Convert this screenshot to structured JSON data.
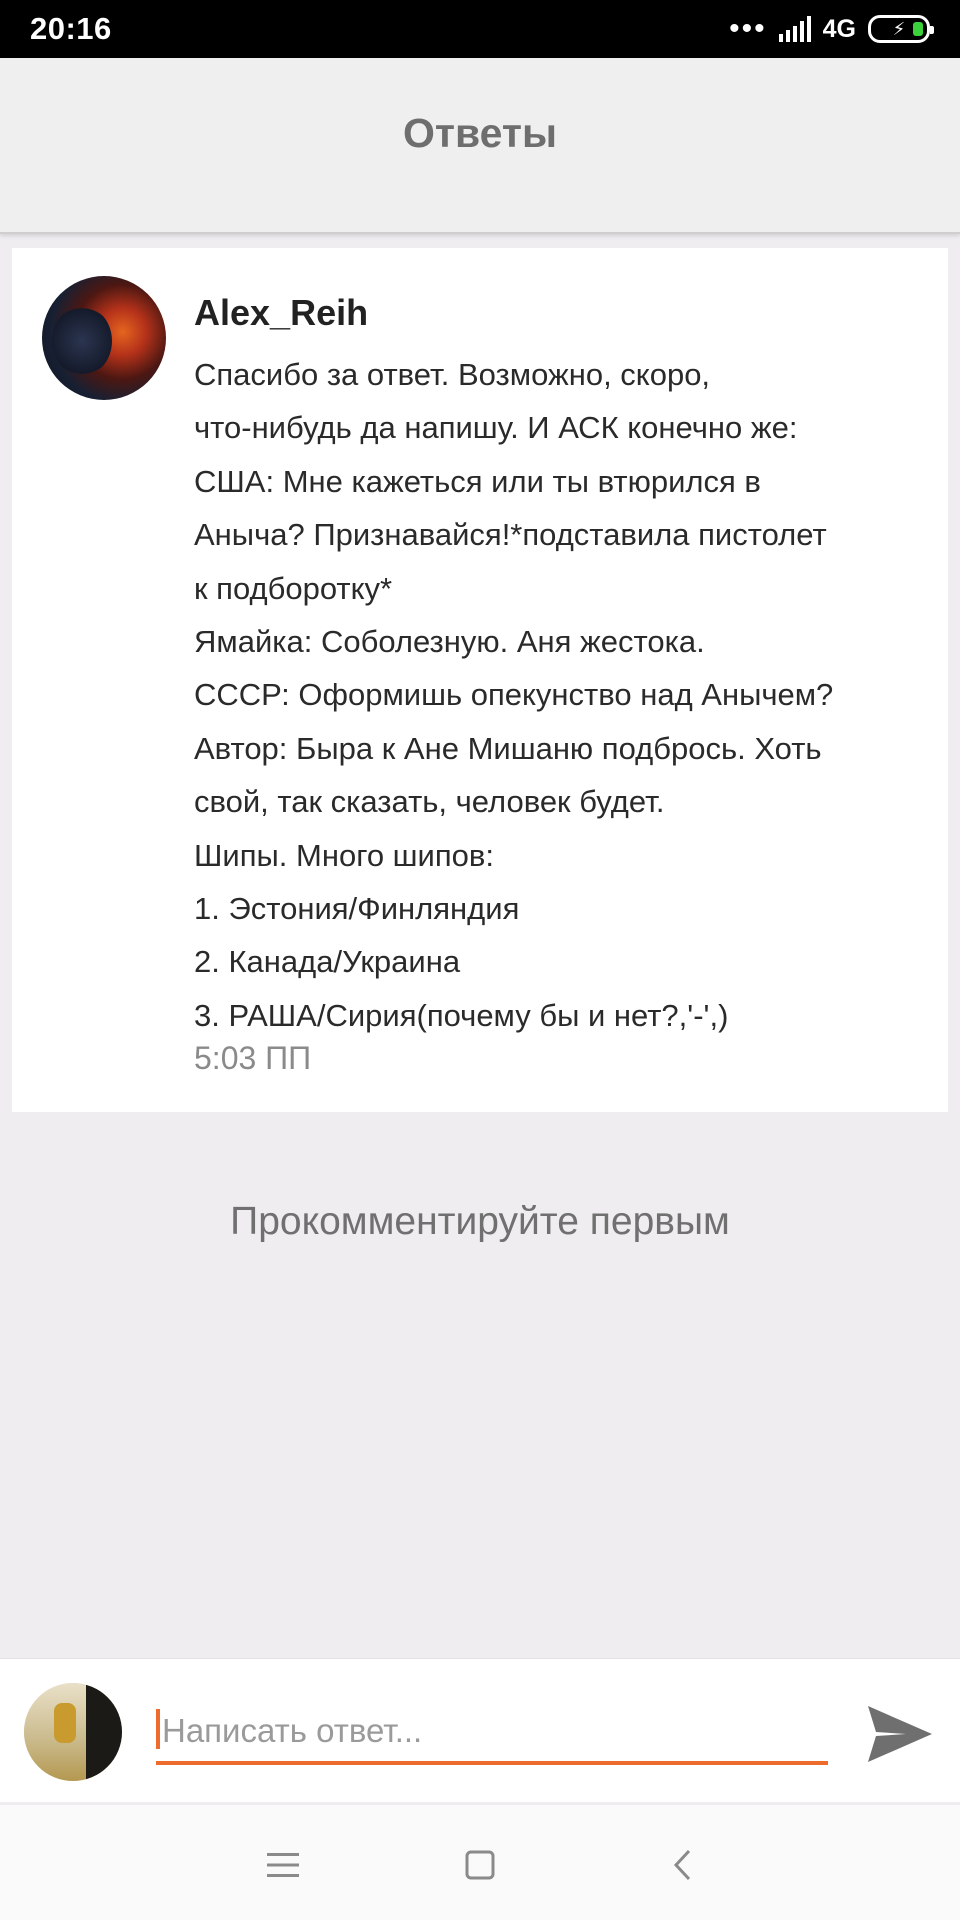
{
  "status_bar": {
    "time": "20:16",
    "network": "4G"
  },
  "header": {
    "title": "Ответы"
  },
  "comment": {
    "author": "Alex_Reih",
    "lines": [
      "Спасибо за ответ. Возможно, скоро,",
      "что-нибудь да напишу. И АСК конечно же:",
      "США: Мне кажеться или ты втюрился в",
      "Аныча? Признавайся!*подставила пистолет",
      "к подборотку*",
      "Ямайка: Соболезную. Аня жестока.",
      "СССР: Оформишь опекунство над Анычем?",
      "Автор: Быра к Ане Мишаню подбрось. Хоть",
      "свой, так сказать, человек будет.",
      "Шипы. Много шипов:",
      "1. Эстония/Финляндия",
      "2. Канада/Украина",
      "3. РАША/Сирия(почему бы и нет?,'-',)"
    ],
    "time": "5:03 ПП"
  },
  "empty_state": {
    "text": "Прокомментируйте первым"
  },
  "reply": {
    "placeholder": "Написать ответ..."
  },
  "colors": {
    "accent": "#ee6b2e",
    "background": "#efedf0",
    "battery_charge": "#3ad13a"
  },
  "icons": {
    "send": "send-icon",
    "menu": "menu-icon",
    "home": "home-square-icon",
    "back": "back-chevron-icon"
  }
}
